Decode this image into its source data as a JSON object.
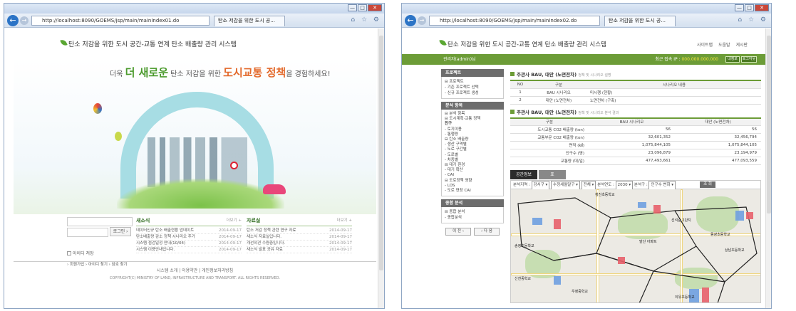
{
  "window1": {
    "address": "http://localhost:8090/GOEMS/jsp/main/mainIndex01.do",
    "address_host": "localhost",
    "tab_label": "탄소 저감을 위한 도시 공...",
    "site_title": "탄소 저감을 위한 도시 공간-교통 연계 탄소 배출량 관리 시스템",
    "headline": {
      "pre": "더욱 ",
      "hi1": "더 새로운",
      "mid": " 탄소 저감을 위한 ",
      "hi2": "도시교통 정책",
      "post": "을 경험하세요!"
    },
    "login": {
      "button": "로그인 ›",
      "remember": "아이디 저장",
      "links": "› 회원가입   › 아이디 찾기   › 암호 찾기"
    },
    "notice": {
      "title": "새소식",
      "more": "더보기 +",
      "rows": [
        {
          "t": "데이터신규 탄소 배출현황 업데이트",
          "d": "2014-09-17"
        },
        {
          "t": "탄소배출량 감소 정책 시나리오 추가",
          "d": "2014-09-17"
        },
        {
          "t": "시스템 점검일정 안내(10/04)",
          "d": "2014-09-17"
        },
        {
          "t": "시스템 이용안내입니다.",
          "d": "2014-09-17"
        }
      ]
    },
    "archive": {
      "title": "자료실",
      "more": "더보기 +",
      "rows": [
        {
          "t": "탄소 저감 정책 관련 연구 자료",
          "d": "2014-09-17"
        },
        {
          "t": "새소식 자료실입니다.",
          "d": "2014-09-17"
        },
        {
          "t": "개선의견 수렴중입니다.",
          "d": "2014-09-17"
        },
        {
          "t": "새소식 발표 공유 자료",
          "d": "2014-09-17"
        }
      ]
    },
    "footer": {
      "links": "시스템 소개   |   이용약관   |   개인정보처리방침",
      "copyright": "COPYRIGHT(C) MINISTRY OF LAND, INFRASTRUCTURE AND TRANSPORT. ALL RIGHTS RESERVED."
    }
  },
  "window2": {
    "address": "http://localhost:8090/GOEMS/jsp/main/mainIndex02.do",
    "tab_label": "탄소 저감을 위한 도시 공...",
    "site_title": "탄소 저감을 위한 도시 공간-교통 연계 탄소 배출량 관리 시스템",
    "top_menu": "사이트맵   도움말   게시판",
    "greeting": "관리자(admin)님",
    "last_login_label": "최근 접속 IP :",
    "last_login_value": "000.000.000.000",
    "btn_info": "내정보",
    "btn_logout": "로그아웃",
    "sidebar": {
      "project_title": "프로젝트",
      "project_items": [
        "⊟ 프로젝트",
        " - 기존 프로젝트 선택",
        " - 신규 프로젝트 생성"
      ],
      "analysis_title": "분석 항목",
      "analysis_items": [
        "⊟ 분석 항목",
        " ⊟ 도시계획·교통 정책",
        "   친구",
        "    - 토지이용",
        "    - 통행량",
        " ⊟ 탄소 배출량",
        "    - 생산 구역별",
        "    - 도로 구간별",
        "    - 도로별",
        "    - 차종별",
        " ⊟ 대기 환경",
        "    - 대기 확산",
        "    - CAI",
        " ⊟ 도로정책 영향",
        "    - LOS",
        "    - 도로 연장 CAI"
      ],
      "result_title": "종합 분석",
      "result_items": [
        "⊟ 종합 분석",
        "  - 종합분석"
      ],
      "btn_prev": "이 전 ‹",
      "btn_next": "› 다 음"
    },
    "section1": {
      "title": "주관사 BAU, 대안 (노면전차)",
      "note": "정책 및 시나리오 설명",
      "headers": [
        "NO",
        "구분",
        "시나리오 내용"
      ],
      "rows": [
        [
          "1",
          "BAU 시나리오",
          "미시행 (현황)"
        ],
        [
          "2",
          "대안 (노면전차)",
          "노면전차 (구축)"
        ]
      ]
    },
    "section2": {
      "title": "주관사 BAU, 대안 (노면전차)",
      "note": "정책 및 시나리오 분석 결과",
      "headers": [
        "구분",
        "BAU 시나리오",
        "대안 (노면전차)"
      ],
      "rows": [
        [
          "도시교통 CO2 배출량 (ton)",
          "56",
          "56"
        ],
        [
          "교통부문 CO2 배출량 (ton)",
          "32,601,352",
          "32,456,794"
        ],
        [
          "면적 (㎢)",
          "1,075,844,105",
          "1,075,844,105"
        ],
        [
          "인구수 (명)",
          "23,096,879",
          "23,194,979"
        ],
        [
          "교통량 (대/일)",
          "477,493,661",
          "477,093,559"
        ]
      ]
    },
    "map_tabs": [
      "공간정보",
      "표"
    ],
    "filter": {
      "label_region": "분석지역 :",
      "sel1": "강서구 ▾",
      "sel2": "수정세월말구 ▾",
      "sel3": "전체 ▾",
      "label_year": "분석연도 :",
      "sel_year": "2030 ▾",
      "label_sort": "분석구 :",
      "sel_sort": "인구수 변화 ▾",
      "btn": "조 회"
    },
    "map_labels": [
      "청진초등학교",
      "송정초등학교",
      "신천중학교",
      "선석순 2단지",
      "발산 아파트",
      "동광초등학교",
      "상남초등학교",
      "우정중학교",
      "이유초등학교"
    ],
    "colors": {
      "accent": "#6c9c37",
      "bar_red": "#e8606a",
      "bar_blue": "#6fa0e0"
    }
  }
}
